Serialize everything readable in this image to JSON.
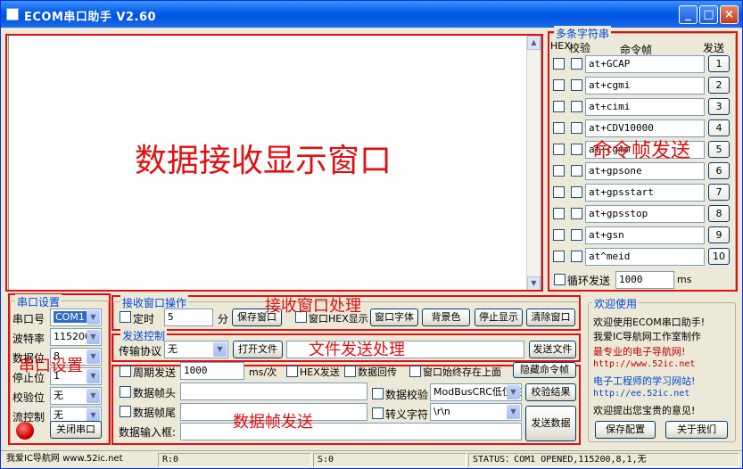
{
  "window": {
    "title": "ECOM串口助手  V2.60",
    "min": "_",
    "max": "□",
    "close": "×"
  },
  "annotations": {
    "recv_display": "数据接收显示窗口",
    "cmd_send": "命令帧发送",
    "recv_process": "接收窗口处理",
    "file_process": "文件发送处理",
    "port_setup": "串口设置",
    "frame_send": "数据帧发送"
  },
  "multi": {
    "group": "多条字符串",
    "hex_header": "HEX",
    "check_header": "校验",
    "cmd_header": "命令帧",
    "send_header": "发送",
    "commands": [
      "at+GCAP",
      "at+cgmi",
      "at+cimi",
      "at+CDV10000",
      "at+cgmm",
      "at+gpsone",
      "at+gpsstart",
      "at+gpsstop",
      "at+gsn",
      "at^meid"
    ],
    "numbers": [
      "1",
      "2",
      "3",
      "4",
      "5",
      "6",
      "7",
      "8",
      "9",
      "10"
    ],
    "loop_label": "循环发送",
    "loop_value": "1000",
    "loop_unit": "ms"
  },
  "port": {
    "group": "串口设置",
    "port_label": "串口号",
    "port_value": "COM1",
    "baud_label": "波特率",
    "baud_value": "115200",
    "data_label": "数据位",
    "data_value": "8",
    "stop_label": "停止位",
    "stop_value": "1",
    "parity_label": "校验位",
    "parity_value": "无",
    "flow_label": "流控制",
    "flow_value": "无",
    "close_button": "关闭串口"
  },
  "recv": {
    "group": "接收窗口操作",
    "timer_label": "定时",
    "timer_value": "5",
    "timer_unit": "分",
    "save_button": "保存窗口",
    "hex_label": "窗口HEX显示",
    "font_button": "窗口字体",
    "bg_button": "背景色",
    "stop_button": "停止显示",
    "clear_button": "清除窗口"
  },
  "send": {
    "group": "发送控制",
    "protocol_label": "传输协议",
    "protocol_value": "无",
    "open_button": "打开文件",
    "file_path": "",
    "send_file_button": "发送文件"
  },
  "frame": {
    "period_label": "周期发送",
    "period_value": "1000",
    "period_unit": "ms/次",
    "hexsend_label": "HEX发送",
    "echo_label": "数据回传",
    "topmost_label": "窗口始终存在上面",
    "hide_button": "隐藏命令帧",
    "header_label": "数据帧头",
    "header_value": "",
    "checksum_label": "数据校验",
    "checksum_value": "ModBusCRC低位在",
    "checksum_button": "校验结果",
    "tail_label": "数据帧尾",
    "tail_value": "",
    "escape_label": "转义字符",
    "escape_value": "\\r\\n",
    "input_label": "数据输入框:",
    "input_value": "",
    "send_button": "发送数据"
  },
  "welcome": {
    "group": "欢迎使用",
    "line1": "欢迎使用ECOM串口助手!",
    "line2": "我爱IC导航网工作室制作",
    "line3": "最专业的电子导航网!",
    "line4": "http://www.52ic.net",
    "line5": "电子工程师的学习网站!",
    "line6": "http://ee.52ic.net",
    "line7": "欢迎提出您宝贵的意见!",
    "config_button": "保存配置",
    "about_button": "关于我们"
  },
  "status": {
    "site": "我爱IC导航网 www.52ic.net",
    "rx": "R:0",
    "tx": "S:0",
    "state": "STATUS：COM1 OPENED,115200,8,1,无"
  },
  "colors": {
    "annotation": "#e01010",
    "group_label": "#0046d5",
    "link": "#c00000",
    "titlebar": "#0054e3"
  }
}
